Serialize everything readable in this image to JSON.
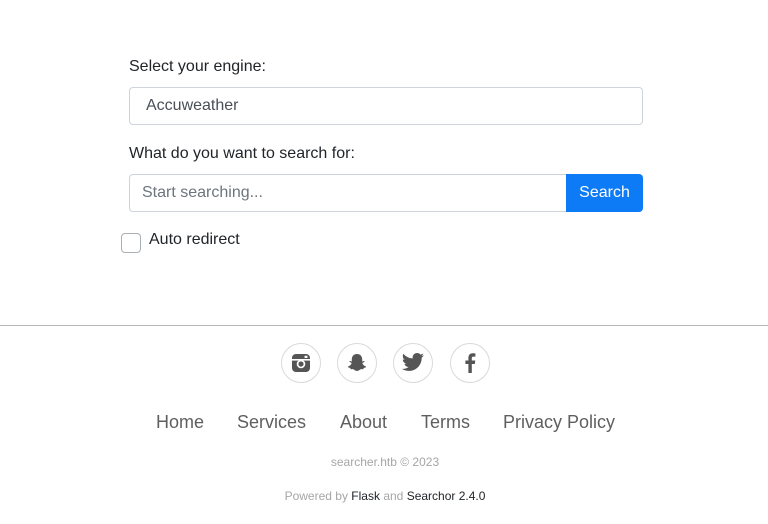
{
  "form": {
    "engine_label": "Select your engine:",
    "engine_selected": "Accuweather",
    "query_label": "What do you want to search for:",
    "query_placeholder": "Start searching...",
    "search_button": "Search",
    "auto_redirect_label": "Auto redirect",
    "auto_redirect_checked": false
  },
  "footer": {
    "social_icons": [
      "instagram-icon",
      "snapchat-icon",
      "twitter-icon",
      "facebook-icon"
    ],
    "nav": {
      "home": "Home",
      "services": "Services",
      "about": "About",
      "terms": "Terms",
      "privacy": "Privacy Policy"
    },
    "copyright": "searcher.htb © 2023",
    "powered_prefix": "Powered by",
    "powered_flask": "Flask",
    "powered_and": "and",
    "powered_searchor": "Searchor 2.4.0"
  },
  "colors": {
    "accent": "#0d7bf6",
    "footer_text": "#a6a6a6",
    "nav_text": "#5f5f5f"
  }
}
